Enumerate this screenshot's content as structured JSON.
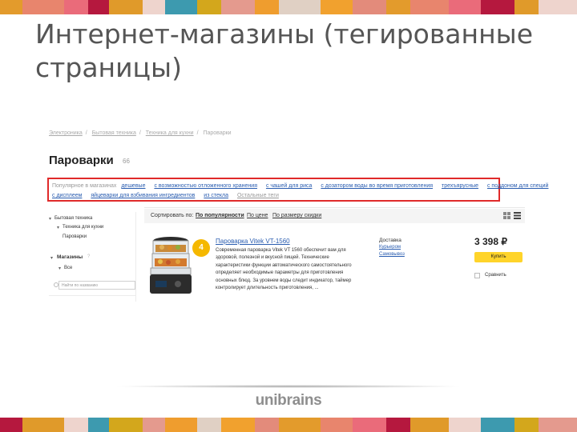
{
  "slide": {
    "title": "Интернет-магазины (тегированные страницы)",
    "logo_text": "unibrains",
    "stripe_colors": [
      "#e39b2c",
      "#e8856d",
      "#ea6b7a",
      "#b5183e",
      "#e09a2a",
      "#eed4cd",
      "#3d9aaf",
      "#d3a71c",
      "#e49a8e",
      "#ef9d2e",
      "#e0d0c4",
      "#f1a12e",
      "#e38b7b"
    ]
  },
  "breadcrumbs": [
    "Электроника",
    "Бытовая техника",
    "Техника для кухни",
    "Пароварки"
  ],
  "page": {
    "title": "Пароварки",
    "count": "66"
  },
  "tags": {
    "label": "Популярное в магазинах",
    "row1": [
      "дешевые",
      "с возможностью отложенного хранения",
      "с чашей для риса",
      "с дозатором воды во время приготовления",
      "трехъярусные",
      "с поддоном для специй"
    ],
    "row2": [
      "с дисплеем",
      "яйцеварки для взбивания ингредиентов",
      "из стекла"
    ],
    "more_label": "Остальные теги"
  },
  "sort": {
    "label": "Сортировать по:",
    "options": [
      "По популярности",
      "По цене",
      "По размеру скидки"
    ]
  },
  "sidebar": {
    "section1": "Бытовая техника",
    "sub1": "Техника для кухни",
    "sub2": "Пароварки",
    "section2": "Магазины",
    "radio_all": "Все",
    "search_placeholder": "Найти по названию"
  },
  "product": {
    "name": "Пароварка Vitek VT-1560",
    "badge_text": "4",
    "description": "Современная пароварка Vitek VT 1560 обеспечит вам для здоровой, полезной и вкусной пищей. Технические характеристики функции автоматического самостоятельного определяет необходимые параметры для приготовления основных блюд. За уровнем воды следит индикатор, таймер контролирует длительность приготовления, ...",
    "delivery_label": "Доставка",
    "delivery_links": [
      "Курьером",
      "Самовывоз"
    ],
    "price": "3 398 ₽",
    "buy_label": "Купить",
    "compare_label": "Сравнить"
  }
}
